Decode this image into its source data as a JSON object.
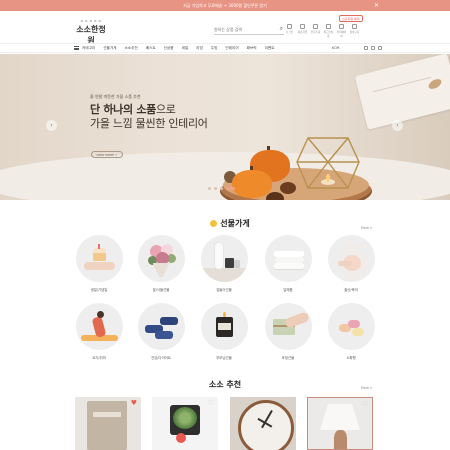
{
  "topbar": {
    "text": "지금 가입하고 무료배송 + 3000원 할인쿠폰 받기",
    "close_label": "✕",
    "bg_color": "#e89484"
  },
  "header": {
    "logo_deco": "✿ ✿ ✿ ✿ ✿",
    "logo_text": "소소한정원",
    "member_badge": "신규회원 혜택",
    "search_placeholder": "원하는 상품 검색",
    "search_icon": "search-icon",
    "utility_links": [
      {
        "label": "로그인",
        "icon": "user-icon"
      },
      {
        "label": "회원가입",
        "icon": "user-plus-icon"
      },
      {
        "label": "주문조회",
        "icon": "truck-icon"
      },
      {
        "label": "최근본상품",
        "icon": "eye-icon"
      },
      {
        "label": "마이페이지",
        "icon": "home-icon"
      },
      {
        "label": "장바구니",
        "icon": "cart-icon"
      }
    ]
  },
  "gnb": {
    "menu_icon": "hamburger-icon",
    "items": [
      "카테고리",
      "선물가게",
      "소소추천",
      "베스트",
      "신상품",
      "세일",
      "리빙",
      "주방",
      "인테리어",
      "패브릭",
      "이벤트"
    ],
    "lang": "KOR"
  },
  "hero": {
    "small_text": "올 연말 따뜻한 가을 소품 추천",
    "title_line1_bold": "단 하나의 소품",
    "title_line1_rest": "으로",
    "title_line2": "가을 느낌 물씬한 인테리어",
    "more_button": "VIEW MORE  >",
    "prev_arrow": "‹",
    "next_arrow": "›",
    "slide_count": 4,
    "active_slide": 3
  },
  "gift_shop": {
    "title": "선물가게",
    "more": "More  >",
    "categories": [
      {
        "label": "생일/기념일",
        "icon": "birthday-cake"
      },
      {
        "label": "꽃/식물선물",
        "icon": "flower-bouquet"
      },
      {
        "label": "집들이선물",
        "icon": "vase"
      },
      {
        "label": "답례품",
        "icon": "towel-stack"
      },
      {
        "label": "출산/육아",
        "icon": "pregnant-belly"
      },
      {
        "label": "요가/취미",
        "icon": "yoga"
      },
      {
        "label": "건강/다이어트",
        "icon": "dumbbell"
      },
      {
        "label": "부모님선물",
        "icon": "candle"
      },
      {
        "label": "포장선물",
        "icon": "gift-wrap"
      },
      {
        "label": "소확행",
        "icon": "macaron"
      }
    ]
  },
  "recommend": {
    "title": "소소 추천",
    "more": "More  >",
    "products": [
      {
        "name": "notebook",
        "liked": true
      },
      {
        "name": "succulent-planter",
        "liked": false
      },
      {
        "name": "wall-clock",
        "liked": false
      },
      {
        "name": "table-lamp",
        "liked": false
      }
    ]
  },
  "colors": {
    "accent": "#e89484",
    "heart_active": "#e4604f",
    "hero_bg": "#ebe1d6"
  }
}
